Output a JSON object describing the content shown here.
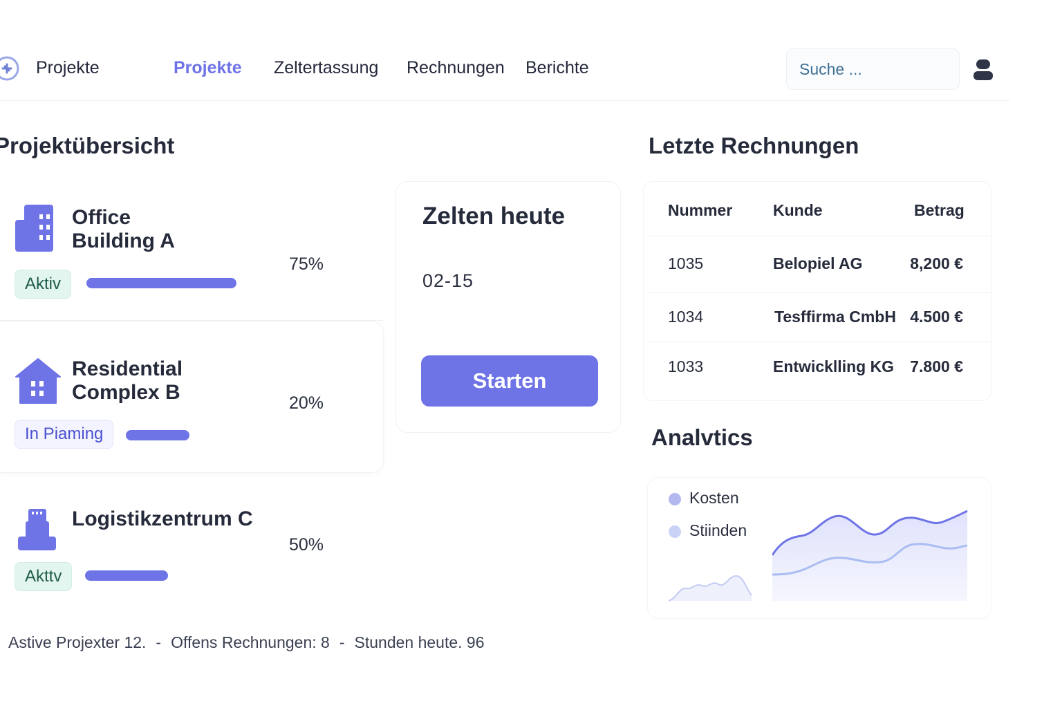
{
  "header": {
    "app_title": "Projekte",
    "nav": [
      {
        "label": "Projekte",
        "active": true
      },
      {
        "label": "Zeltertassung",
        "active": false
      },
      {
        "label": "Rechnungen",
        "active": false
      },
      {
        "label": "Berichte",
        "active": false
      }
    ],
    "search_placeholder": "Suche ...",
    "logo_icon": "logo-icon",
    "user_icon": "user-icon"
  },
  "projects": {
    "title": "Projektübersicht",
    "items": [
      {
        "name_line1": "Office",
        "name_line2": "Building A",
        "status": "Aktiv",
        "status_color": "green",
        "progress": 75,
        "progress_label": "75%",
        "icon": "office-building-icon"
      },
      {
        "name_line1": "Residential",
        "name_line2": "Complex B",
        "status": "In Piaming",
        "status_color": "blue",
        "progress": 20,
        "progress_label": "20%",
        "icon": "house-icon"
      },
      {
        "name_line1": "Logistikzentrum C",
        "name_line2": "",
        "status": "Akttv",
        "status_color": "green",
        "progress": 50,
        "progress_label": "50%",
        "icon": "warehouse-icon"
      }
    ]
  },
  "time": {
    "title": "Zelten heute",
    "value": "02-15",
    "start_label": "Starten"
  },
  "invoices": {
    "title": "Letzte Rechnungen",
    "columns": [
      "Nummer",
      "Kunde",
      "Betrag"
    ],
    "rows": [
      {
        "number": "1035",
        "customer": "Belopiel AG",
        "amount": "8,200 €"
      },
      {
        "number": "1034",
        "customer": "Tesffirma CmbH",
        "amount": "4.500 €"
      },
      {
        "number": "1033",
        "customer": "Entwicklling KG",
        "amount": "7.800 €"
      }
    ]
  },
  "analytics": {
    "title": "Analvtics",
    "legend": [
      {
        "label": "Kosten",
        "color": "#b3b8ef"
      },
      {
        "label": "Stiinden",
        "color": "#c9d3f5"
      }
    ]
  },
  "footer": {
    "active_projects": "Astive Projexter 12.",
    "open_invoices": "Offens Rechnungen: 8",
    "hours_today": "Stunden heute. 96",
    "separator": "-"
  },
  "colors": {
    "accent": "#6e73e6",
    "text": "#262b3b",
    "badge_green_bg": "#e3f5ef",
    "badge_blue_bg": "#f3f4ff"
  }
}
